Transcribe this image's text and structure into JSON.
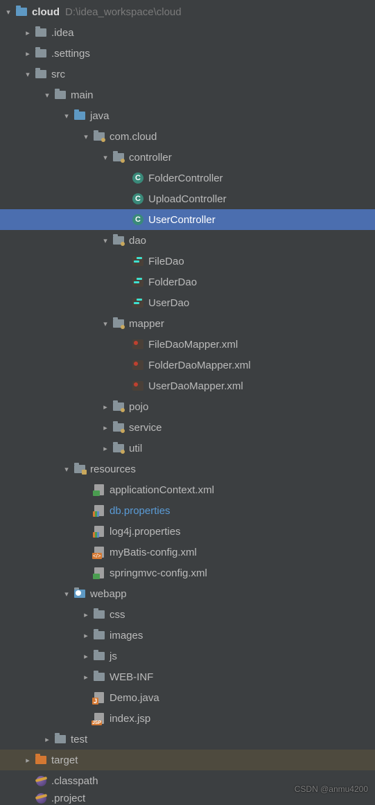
{
  "root": {
    "name": "cloud",
    "path": "D:\\idea_workspace\\cloud"
  },
  "n": {
    "idea": ".idea",
    "settings": ".settings",
    "src": "src",
    "main": "main",
    "java": "java",
    "comcloud": "com.cloud",
    "controller": "controller",
    "FolderController": "FolderController",
    "UploadController": "UploadController",
    "UserController": "UserController",
    "dao": "dao",
    "FileDao": "FileDao",
    "FolderDao": "FolderDao",
    "UserDao": "UserDao",
    "mapper": "mapper",
    "FileDaoMapper": "FileDaoMapper.xml",
    "FolderDaoMapper": "FolderDaoMapper.xml",
    "UserDaoMapper": "UserDaoMapper.xml",
    "pojo": "pojo",
    "service": "service",
    "util": "util",
    "resources": "resources",
    "appctx": "applicationContext.xml",
    "dbprops": "db.properties",
    "log4j": "log4j.properties",
    "mybatis": "myBatis-config.xml",
    "springmvc": "springmvc-config.xml",
    "webapp": "webapp",
    "css": "css",
    "images": "images",
    "js": "js",
    "webinf": "WEB-INF",
    "demojava": "Demo.java",
    "indexjsp": "index.jsp",
    "test": "test",
    "target": "target",
    "classpath": ".classpath",
    "project": ".project"
  },
  "watermark": "CSDN @anmu4200"
}
